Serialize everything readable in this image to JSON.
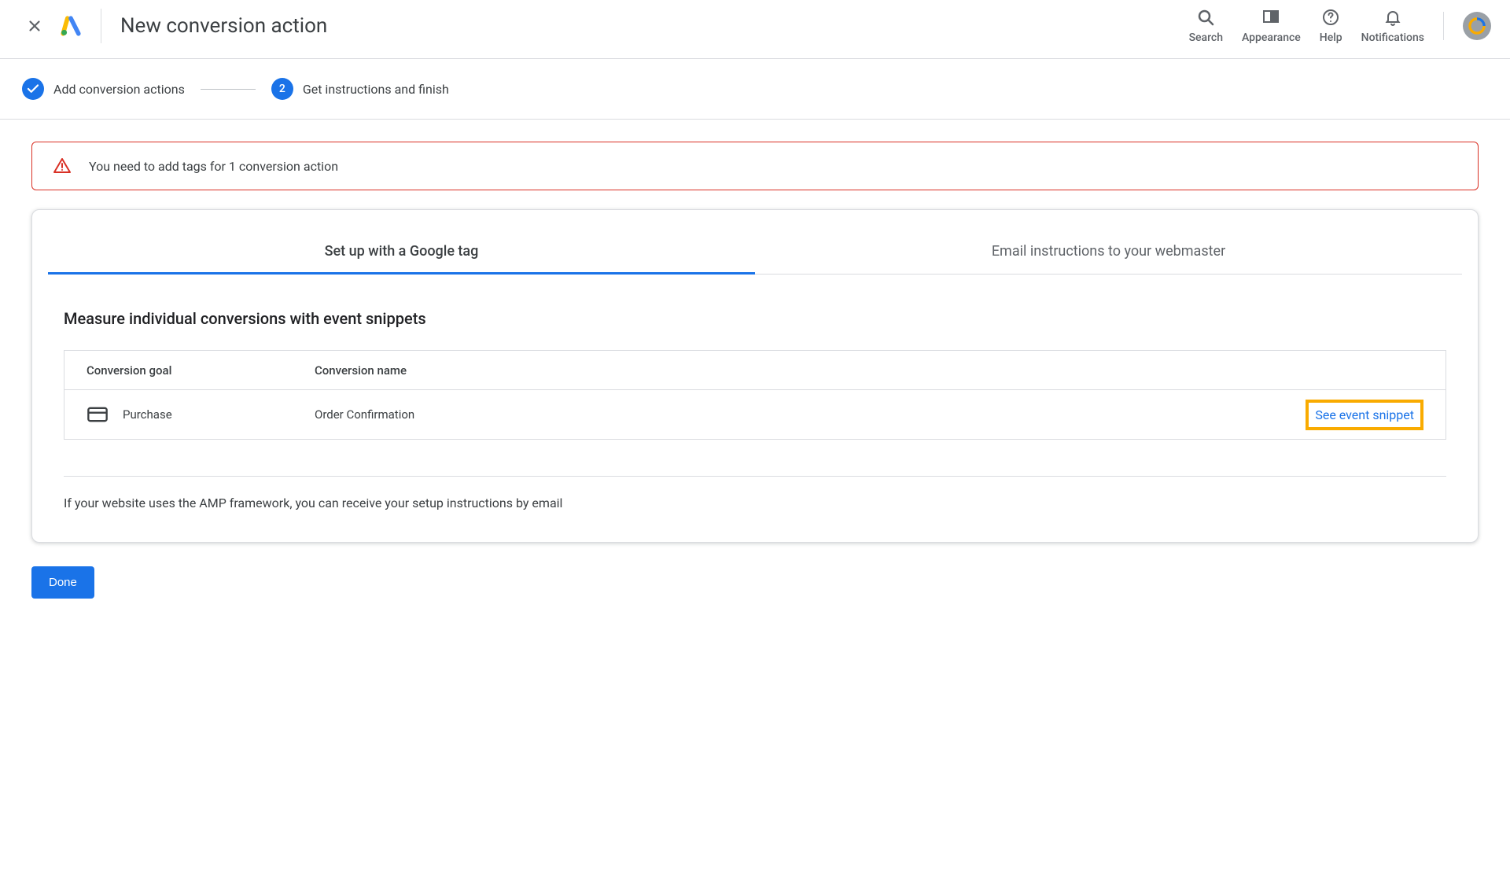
{
  "header": {
    "title": "New conversion action",
    "nav": {
      "search": "Search",
      "appearance": "Appearance",
      "help": "Help",
      "notifications": "Notifications"
    }
  },
  "steps": {
    "step1": {
      "label": "Add conversion actions"
    },
    "step2": {
      "number": "2",
      "label": "Get instructions and finish"
    }
  },
  "alert": {
    "text": "You need to add tags for 1 conversion action"
  },
  "tabs": {
    "tab1": "Set up with a Google tag",
    "tab2": "Email instructions to your webmaster"
  },
  "section": {
    "title": "Measure individual conversions with event snippets"
  },
  "table": {
    "headers": {
      "goal": "Conversion goal",
      "name": "Conversion name"
    },
    "rows": [
      {
        "goal": "Purchase",
        "name": "Order Confirmation",
        "action": "See event snippet"
      }
    ]
  },
  "note": "If your website uses the AMP framework, you can receive your setup instructions by email",
  "buttons": {
    "done": "Done"
  }
}
